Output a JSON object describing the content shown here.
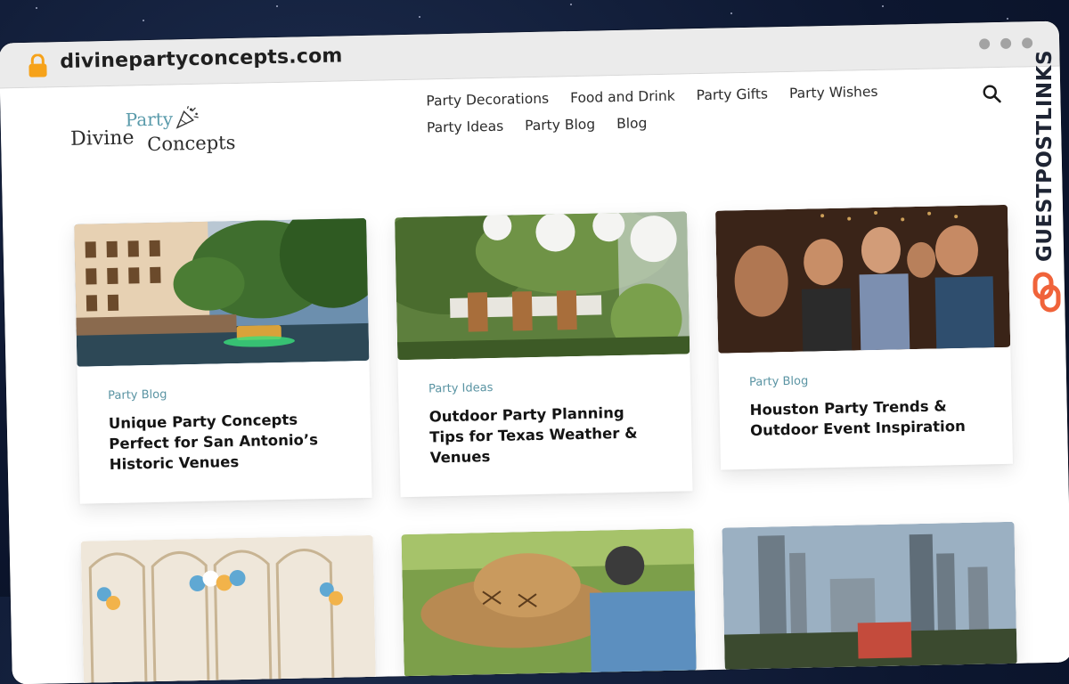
{
  "browser": {
    "url": "divinepartyconcepts.com"
  },
  "logo": {
    "line1": "Party",
    "line2": "Divine",
    "line3": "Concepts"
  },
  "nav": {
    "row1": [
      "Party Decorations",
      "Food and Drink",
      "Party Gifts",
      "Party Wishes"
    ],
    "row2": [
      "Party Ideas",
      "Party Blog",
      "Blog"
    ]
  },
  "cards": [
    {
      "category": "Party Blog",
      "title": "Unique Party Concepts Perfect for San Antonio’s Historic Venues"
    },
    {
      "category": "Party Ideas",
      "title": "Outdoor Party Planning Tips for Texas Weather & Venues"
    },
    {
      "category": "Party Blog",
      "title": "Houston Party Trends & Outdoor Event Inspiration"
    }
  ],
  "watermark": {
    "text": "GUESTPOSTLINKS"
  },
  "colors": {
    "accent": "#5a94a3",
    "watermark_icon": "#f0633a"
  },
  "icons": {
    "lock": "lock-icon",
    "search": "search-icon",
    "logo_mark": "party-popper-icon",
    "watermark_mark": "link-icon"
  }
}
